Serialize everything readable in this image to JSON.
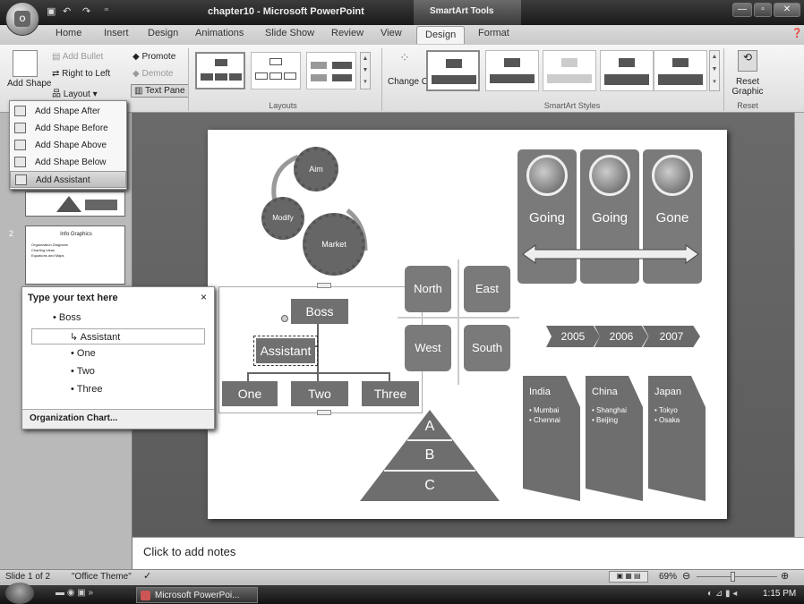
{
  "window": {
    "title": "chapter10 - Microsoft PowerPoint",
    "contextual_tools": "SmartArt Tools"
  },
  "tabs": [
    "Home",
    "Insert",
    "Design",
    "Animations",
    "Slide Show",
    "Review",
    "View",
    "Design",
    "Format"
  ],
  "active_tab_index": 7,
  "ribbon": {
    "add_shape_label": "Add Shape",
    "add_bullet": "Add Bullet",
    "right_to_left": "Right to Left",
    "layout": "Layout",
    "promote": "Promote",
    "demote": "Demote",
    "text_pane": "Text Pane",
    "layouts_group": "Layouts",
    "change_colors": "Change Colors",
    "smartart_styles_group": "SmartArt Styles",
    "reset_graphic": "Reset Graphic",
    "reset_group": "Reset"
  },
  "add_shape_menu": [
    "Add Shape After",
    "Add Shape Before",
    "Add Shape Above",
    "Add Shape Below",
    "Add Assistant"
  ],
  "slides_panel": {
    "slide2_number": "2",
    "slide2_title": "Info Graphics",
    "slide2_bullets": [
      "Organization Diagrams",
      "Charting Ideas",
      "Equations and Maps"
    ]
  },
  "text_pane": {
    "title": "Type your text here",
    "close": "×",
    "items": [
      "Boss",
      "Assistant",
      "One",
      "Two",
      "Three"
    ],
    "footer": "Organization Chart..."
  },
  "slide": {
    "gears": [
      "Aim",
      "Modify",
      "Market"
    ],
    "org_chart": {
      "boss": "Boss",
      "assistant": "Assistant",
      "children": [
        "One",
        "Two",
        "Three"
      ]
    },
    "quadrants": [
      "North",
      "East",
      "West",
      "South"
    ],
    "pyramid": [
      "A",
      "B",
      "C"
    ],
    "cards": [
      "Going",
      "Going",
      "Gone"
    ],
    "timeline": [
      "2005",
      "2006",
      "2007"
    ],
    "countries": [
      {
        "name": "India",
        "cities": [
          "Mumbai",
          "Chennai"
        ]
      },
      {
        "name": "China",
        "cities": [
          "Shanghai",
          "Beijing"
        ]
      },
      {
        "name": "Japan",
        "cities": [
          "Tokyo",
          "Osaka"
        ]
      }
    ]
  },
  "notes_placeholder": "Click to add notes",
  "status": {
    "slide_info": "Slide 1 of 2",
    "theme": "\"Office Theme\"",
    "zoom": "69%"
  },
  "taskbar": {
    "app": "Microsoft PowerPoi...",
    "time": "1:15 PM"
  },
  "colors": {
    "smartart_gray": "#6b6b6b",
    "slide_bg": "#ffffff",
    "workspace": "#5f5f5f"
  }
}
